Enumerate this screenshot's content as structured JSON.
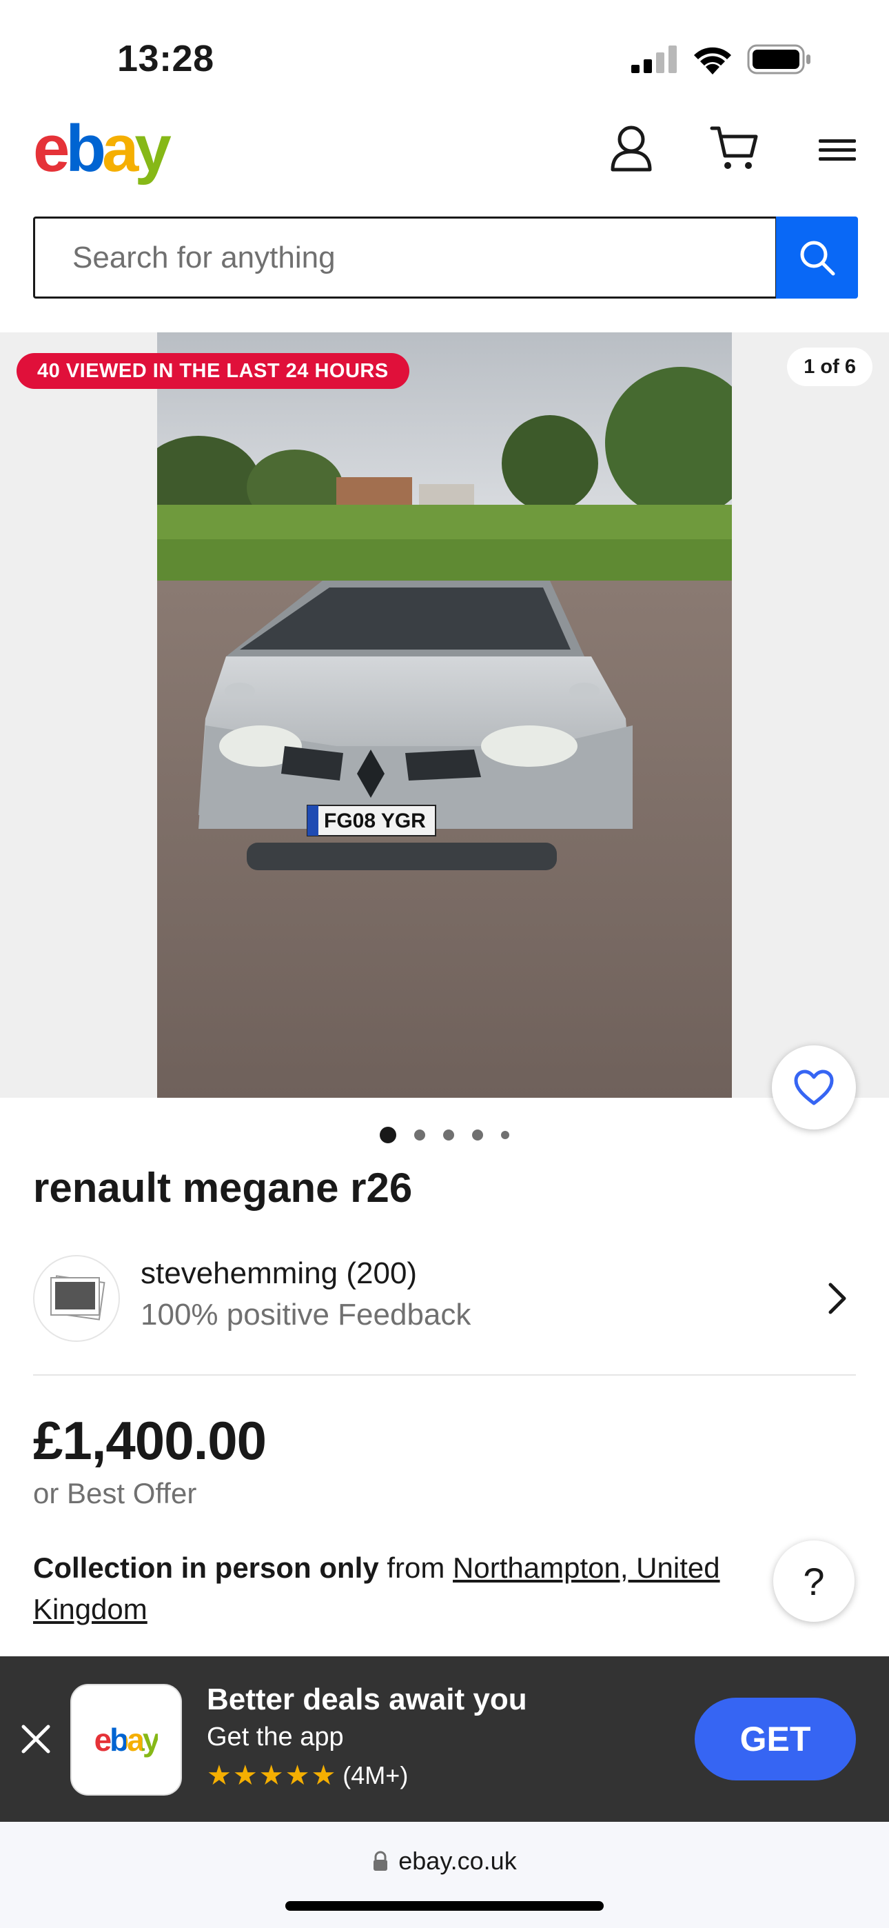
{
  "status_bar": {
    "time": "13:28"
  },
  "header": {
    "logo_letters": [
      "e",
      "b",
      "a",
      "y"
    ],
    "logo_colors": [
      "#e53238",
      "#0064d2",
      "#f5af02",
      "#86b817"
    ],
    "icons": [
      "user-icon",
      "cart-icon",
      "menu-icon"
    ]
  },
  "search": {
    "placeholder": "Search for anything",
    "value": ""
  },
  "gallery": {
    "viewed_badge": "40 VIEWED IN THE LAST 24 HOURS",
    "counter": "1 of 6",
    "plate_text": "FG08 YGR",
    "dot_count": 5,
    "active_dot": 0
  },
  "listing": {
    "title": "renault megane r26",
    "seller_name": "stevehemming (200)",
    "seller_feedback": "100% positive Feedback",
    "price": "£1,400.00",
    "price_note": "or Best Offer",
    "collection_bold": "Collection in person only",
    "collection_from": " from ",
    "collection_location": "Northampton, United Kingdom",
    "help_label": "?"
  },
  "app_banner": {
    "app_icon_text": "ebay",
    "title": "Better deals await you",
    "subtitle": "Get the app",
    "stars": "★★★★★",
    "rating_count": "(4M+)",
    "get_label": "GET"
  },
  "browser": {
    "url": "ebay.co.uk"
  },
  "colors": {
    "accent": "#0968f6",
    "badge": "#e0103a",
    "get_button": "#3665f3",
    "banner_bg": "#333333"
  }
}
